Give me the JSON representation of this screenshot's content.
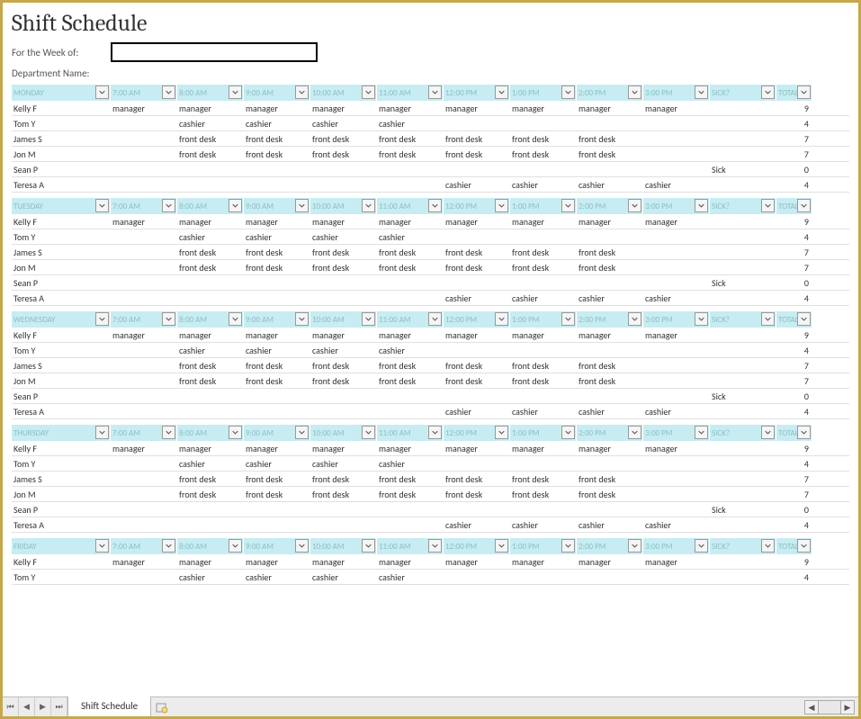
{
  "title": "Shift Schedule",
  "meta": {
    "week_label": "For the Week of:",
    "week_value": "",
    "dept_label": "Department Name:"
  },
  "time_headers": [
    "7:00 AM",
    "8:00 AM",
    "9:00 AM",
    "10:00 AM",
    "11:00 AM",
    "12:00 PM",
    "1:00 PM",
    "2:00 PM",
    "3:00 PM",
    "SICK?"
  ],
  "total_header": "TOTAL",
  "days": [
    {
      "name": "MONDAY",
      "rows": [
        {
          "name": "Kelly F",
          "cells": [
            "manager",
            "manager",
            "manager",
            "manager",
            "manager",
            "manager",
            "manager",
            "manager",
            "manager",
            ""
          ],
          "total": "9"
        },
        {
          "name": "Tom Y",
          "cells": [
            "",
            "cashier",
            "cashier",
            "cashier",
            "cashier",
            "",
            "",
            "",
            "",
            ""
          ],
          "total": "4"
        },
        {
          "name": "James S",
          "cells": [
            "",
            "front desk",
            "front desk",
            "front desk",
            "front desk",
            "front desk",
            "front desk",
            "front desk",
            "",
            ""
          ],
          "total": "7"
        },
        {
          "name": "Jon M",
          "cells": [
            "",
            "front desk",
            "front desk",
            "front desk",
            "front desk",
            "front desk",
            "front desk",
            "front desk",
            "",
            ""
          ],
          "total": "7"
        },
        {
          "name": "Sean P",
          "cells": [
            "",
            "",
            "",
            "",
            "",
            "",
            "",
            "",
            "",
            "Sick"
          ],
          "total": "0"
        },
        {
          "name": "Teresa A",
          "cells": [
            "",
            "",
            "",
            "",
            "",
            "cashier",
            "cashier",
            "cashier",
            "cashier",
            ""
          ],
          "total": "4"
        }
      ]
    },
    {
      "name": "TUESDAY",
      "rows": [
        {
          "name": "Kelly F",
          "cells": [
            "manager",
            "manager",
            "manager",
            "manager",
            "manager",
            "manager",
            "manager",
            "manager",
            "manager",
            ""
          ],
          "total": "9"
        },
        {
          "name": "Tom Y",
          "cells": [
            "",
            "cashier",
            "cashier",
            "cashier",
            "cashier",
            "",
            "",
            "",
            "",
            ""
          ],
          "total": "4"
        },
        {
          "name": "James S",
          "cells": [
            "",
            "front desk",
            "front desk",
            "front desk",
            "front desk",
            "front desk",
            "front desk",
            "front desk",
            "",
            ""
          ],
          "total": "7"
        },
        {
          "name": "Jon M",
          "cells": [
            "",
            "front desk",
            "front desk",
            "front desk",
            "front desk",
            "front desk",
            "front desk",
            "front desk",
            "",
            ""
          ],
          "total": "7"
        },
        {
          "name": "Sean P",
          "cells": [
            "",
            "",
            "",
            "",
            "",
            "",
            "",
            "",
            "",
            "Sick"
          ],
          "total": "0"
        },
        {
          "name": "Teresa A",
          "cells": [
            "",
            "",
            "",
            "",
            "",
            "cashier",
            "cashier",
            "cashier",
            "cashier",
            ""
          ],
          "total": "4"
        }
      ]
    },
    {
      "name": "WEDNESDAY",
      "rows": [
        {
          "name": "Kelly F",
          "cells": [
            "manager",
            "manager",
            "manager",
            "manager",
            "manager",
            "manager",
            "manager",
            "manager",
            "manager",
            ""
          ],
          "total": "9"
        },
        {
          "name": "Tom Y",
          "cells": [
            "",
            "cashier",
            "cashier",
            "cashier",
            "cashier",
            "",
            "",
            "",
            "",
            ""
          ],
          "total": "4"
        },
        {
          "name": "James S",
          "cells": [
            "",
            "front desk",
            "front desk",
            "front desk",
            "front desk",
            "front desk",
            "front desk",
            "front desk",
            "",
            ""
          ],
          "total": "7"
        },
        {
          "name": "Jon M",
          "cells": [
            "",
            "front desk",
            "front desk",
            "front desk",
            "front desk",
            "front desk",
            "front desk",
            "front desk",
            "",
            ""
          ],
          "total": "7"
        },
        {
          "name": "Sean P",
          "cells": [
            "",
            "",
            "",
            "",
            "",
            "",
            "",
            "",
            "",
            "Sick"
          ],
          "total": "0"
        },
        {
          "name": "Teresa A",
          "cells": [
            "",
            "",
            "",
            "",
            "",
            "cashier",
            "cashier",
            "cashier",
            "cashier",
            ""
          ],
          "total": "4"
        }
      ]
    },
    {
      "name": "THURSDAY",
      "rows": [
        {
          "name": "Kelly F",
          "cells": [
            "manager",
            "manager",
            "manager",
            "manager",
            "manager",
            "manager",
            "manager",
            "manager",
            "manager",
            ""
          ],
          "total": "9"
        },
        {
          "name": "Tom Y",
          "cells": [
            "",
            "cashier",
            "cashier",
            "cashier",
            "cashier",
            "",
            "",
            "",
            "",
            ""
          ],
          "total": "4"
        },
        {
          "name": "James S",
          "cells": [
            "",
            "front desk",
            "front desk",
            "front desk",
            "front desk",
            "front desk",
            "front desk",
            "front desk",
            "",
            ""
          ],
          "total": "7"
        },
        {
          "name": "Jon M",
          "cells": [
            "",
            "front desk",
            "front desk",
            "front desk",
            "front desk",
            "front desk",
            "front desk",
            "front desk",
            "",
            ""
          ],
          "total": "7"
        },
        {
          "name": "Sean P",
          "cells": [
            "",
            "",
            "",
            "",
            "",
            "",
            "",
            "",
            "",
            "Sick"
          ],
          "total": "0"
        },
        {
          "name": "Teresa A",
          "cells": [
            "",
            "",
            "",
            "",
            "",
            "cashier",
            "cashier",
            "cashier",
            "cashier",
            ""
          ],
          "total": "4"
        }
      ]
    },
    {
      "name": "FRIDAY",
      "rows": [
        {
          "name": "Kelly F",
          "cells": [
            "manager",
            "manager",
            "manager",
            "manager",
            "manager",
            "manager",
            "manager",
            "manager",
            "manager",
            ""
          ],
          "total": "9"
        },
        {
          "name": "Tom Y",
          "cells": [
            "",
            "cashier",
            "cashier",
            "cashier",
            "cashier",
            "",
            "",
            "",
            "",
            ""
          ],
          "total": "4"
        }
      ]
    }
  ],
  "tabs": {
    "active": "Shift Schedule"
  }
}
